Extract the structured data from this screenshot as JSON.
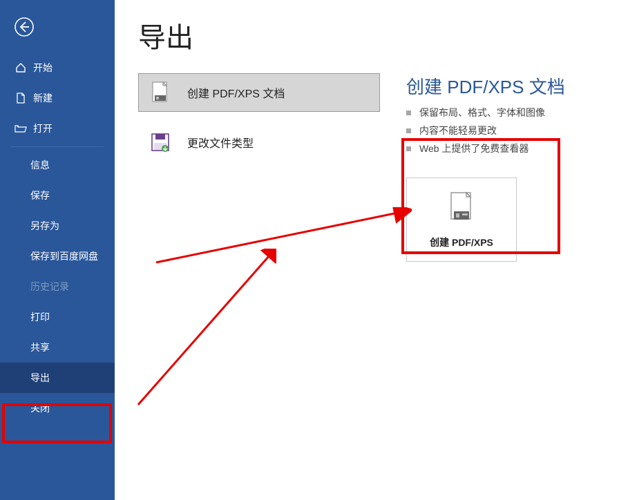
{
  "page": {
    "title": "导出"
  },
  "sidebar": {
    "items": [
      {
        "label": "开始"
      },
      {
        "label": "新建"
      },
      {
        "label": "打开"
      },
      {
        "label": "信息"
      },
      {
        "label": "保存"
      },
      {
        "label": "另存为"
      },
      {
        "label": "保存到百度网盘"
      },
      {
        "label": "历史记录"
      },
      {
        "label": "打印"
      },
      {
        "label": "共享"
      },
      {
        "label": "导出"
      },
      {
        "label": "关闭"
      }
    ]
  },
  "options": {
    "create_pdf": "创建 PDF/XPS 文档",
    "change_type": "更改文件类型"
  },
  "detail": {
    "title": "创建 PDF/XPS 文档",
    "bullets": [
      "保留布局、格式、字体和图像",
      "内容不能轻易更改",
      "Web 上提供了免费查看器"
    ],
    "button_label": "创建 PDF/XPS"
  }
}
